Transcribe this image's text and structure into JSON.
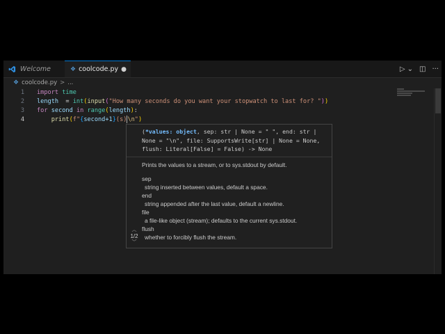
{
  "tabs": [
    {
      "label": "Welcome",
      "icon": "vscode-logo-icon"
    },
    {
      "label": "coolcode.py",
      "icon": "python-icon",
      "dirty_marker": "●"
    }
  ],
  "actions": {
    "run": "▷",
    "dropdown": "⌄",
    "split": "◫",
    "more": "···"
  },
  "breadcrumb": {
    "file": "coolcode.py",
    "sep": ">",
    "rest": "..."
  },
  "line_numbers": [
    "1",
    "2",
    "3",
    "4"
  ],
  "code": {
    "line1": {
      "kw": "import",
      "mod": "time"
    },
    "line2": {
      "var": "length",
      "eq": "  = ",
      "fn1": "int",
      "fn2": "input",
      "str": "\"How many seconds do you want your stopwatch to last for? \""
    },
    "line3": {
      "kw1": "for",
      "var": "second",
      "kw2": "in",
      "fn": "range",
      "arg": "length"
    },
    "line4": {
      "indent": "    ",
      "fn": "print",
      "fpre": "f\"",
      "expr": "second+1",
      "mid": "(s)",
      "esc": "\\n",
      "end": "\""
    }
  },
  "hover": {
    "sig_open": "(",
    "sig_active": "*values: object",
    "sig_rest": ", sep: str | None = \" \", end: str | None = \"\\n\", file: SupportsWrite[str] | None = None, flush: Literal[False] = False) -> None",
    "description": "Prints the values to a stream, or to sys.stdout by default.",
    "params": [
      {
        "name": "sep",
        "desc": "string inserted between values, default a space."
      },
      {
        "name": "end",
        "desc": "string appended after the last value, default a newline."
      },
      {
        "name": "file",
        "desc": "a file-like object (stream); defaults to the current sys.stdout."
      },
      {
        "name": "flush",
        "desc": "whether to forcibly flush the stream."
      }
    ],
    "overload": "1/2"
  }
}
